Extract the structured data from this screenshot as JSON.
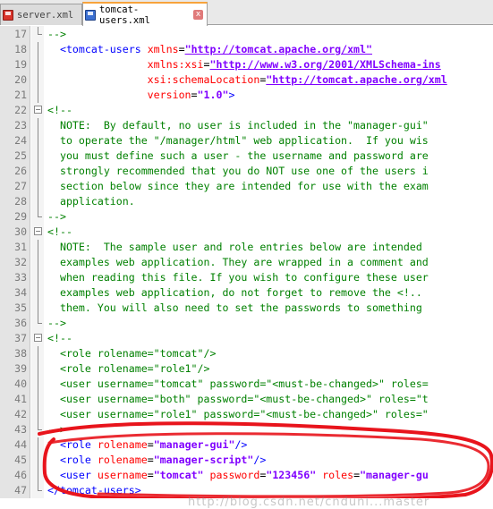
{
  "tabs": [
    {
      "label": "server.xml",
      "active": false,
      "icon": "floppy-red-icon"
    },
    {
      "label": "tomcat-users.xml",
      "active": true,
      "icon": "floppy-blue-icon"
    }
  ],
  "tab_close_glyph": "x",
  "watermark": "http://blog.csdn.net/cnduni...master",
  "lines": [
    {
      "n": "17",
      "fold": "end",
      "segs": [
        {
          "t": "-->",
          "c": "c-comment"
        }
      ]
    },
    {
      "n": "18",
      "fold": "vline",
      "segs": [
        {
          "t": "  ",
          "c": ""
        },
        {
          "t": "<tomcat-users",
          "c": "c-tag"
        },
        {
          "t": " xmlns",
          "c": "c-attr"
        },
        {
          "t": "=",
          "c": "c-eq"
        },
        {
          "t": "\"http://tomcat.apache.org/xml\"",
          "c": "c-url"
        }
      ]
    },
    {
      "n": "19",
      "fold": "vline",
      "segs": [
        {
          "t": "                xmlns:xsi",
          "c": "c-attr"
        },
        {
          "t": "=",
          "c": "c-eq"
        },
        {
          "t": "\"http://www.w3.org/2001/XMLSchema-ins",
          "c": "c-url"
        }
      ]
    },
    {
      "n": "20",
      "fold": "vline",
      "segs": [
        {
          "t": "                xsi:schemaLocation",
          "c": "c-attr"
        },
        {
          "t": "=",
          "c": "c-eq"
        },
        {
          "t": "\"http://tomcat.apache.org/xml",
          "c": "c-url"
        }
      ]
    },
    {
      "n": "21",
      "fold": "vline",
      "segs": [
        {
          "t": "                version",
          "c": "c-attr"
        },
        {
          "t": "=",
          "c": "c-eq"
        },
        {
          "t": "\"1.0\"",
          "c": "c-val"
        },
        {
          "t": ">",
          "c": "c-tag"
        }
      ]
    },
    {
      "n": "22",
      "fold": "box",
      "segs": [
        {
          "t": "<!--",
          "c": "c-comment"
        }
      ]
    },
    {
      "n": "23",
      "fold": "vline",
      "segs": [
        {
          "t": "  NOTE:  By default, no user is included in the \"manager-gui\"",
          "c": "c-comment"
        }
      ]
    },
    {
      "n": "24",
      "fold": "vline",
      "segs": [
        {
          "t": "  to operate the \"/manager/html\" web application.  If you wis",
          "c": "c-comment"
        }
      ]
    },
    {
      "n": "25",
      "fold": "vline",
      "segs": [
        {
          "t": "  you must define such a user - the username and password are",
          "c": "c-comment"
        }
      ]
    },
    {
      "n": "26",
      "fold": "vline",
      "segs": [
        {
          "t": "  strongly recommended that you do NOT use one of the users i",
          "c": "c-comment"
        }
      ]
    },
    {
      "n": "27",
      "fold": "vline",
      "segs": [
        {
          "t": "  section below since they are intended for use with the exam",
          "c": "c-comment"
        }
      ]
    },
    {
      "n": "28",
      "fold": "vline",
      "segs": [
        {
          "t": "  application.",
          "c": "c-comment"
        }
      ]
    },
    {
      "n": "29",
      "fold": "end",
      "segs": [
        {
          "t": "-->",
          "c": "c-comment"
        }
      ]
    },
    {
      "n": "30",
      "fold": "box",
      "segs": [
        {
          "t": "<!--",
          "c": "c-comment"
        }
      ]
    },
    {
      "n": "31",
      "fold": "vline",
      "segs": [
        {
          "t": "  NOTE:  The sample user and role entries below are intended",
          "c": "c-comment"
        }
      ]
    },
    {
      "n": "32",
      "fold": "vline",
      "segs": [
        {
          "t": "  examples web application. They are wrapped in a comment and",
          "c": "c-comment"
        }
      ]
    },
    {
      "n": "33",
      "fold": "vline",
      "segs": [
        {
          "t": "  when reading this file. If you wish to configure these user",
          "c": "c-comment"
        }
      ]
    },
    {
      "n": "34",
      "fold": "vline",
      "segs": [
        {
          "t": "  examples web application, do not forget to remove the <!..",
          "c": "c-comment"
        }
      ]
    },
    {
      "n": "35",
      "fold": "vline",
      "segs": [
        {
          "t": "  them. You will also need to set the passwords to something",
          "c": "c-comment"
        }
      ]
    },
    {
      "n": "36",
      "fold": "end",
      "segs": [
        {
          "t": "-->",
          "c": "c-comment"
        }
      ]
    },
    {
      "n": "37",
      "fold": "box",
      "segs": [
        {
          "t": "<!--",
          "c": "c-comment"
        }
      ]
    },
    {
      "n": "38",
      "fold": "vline",
      "segs": [
        {
          "t": "  <role rolename=\"tomcat\"/>",
          "c": "c-comment"
        }
      ]
    },
    {
      "n": "39",
      "fold": "vline",
      "segs": [
        {
          "t": "  <role rolename=\"role1\"/>",
          "c": "c-comment"
        }
      ]
    },
    {
      "n": "40",
      "fold": "vline",
      "segs": [
        {
          "t": "  <user username=\"tomcat\" password=\"<must-be-changed>\" roles=",
          "c": "c-comment"
        }
      ]
    },
    {
      "n": "41",
      "fold": "vline",
      "segs": [
        {
          "t": "  <user username=\"both\" password=\"<must-be-changed>\" roles=\"t",
          "c": "c-comment"
        }
      ]
    },
    {
      "n": "42",
      "fold": "vline",
      "segs": [
        {
          "t": "  <user username=\"role1\" password=\"<must-be-changed>\" roles=\"",
          "c": "c-comment"
        }
      ]
    },
    {
      "n": "43",
      "fold": "end",
      "segs": [
        {
          "t": "-->",
          "c": "c-comment"
        }
      ]
    },
    {
      "n": "44",
      "fold": "vline",
      "segs": [
        {
          "t": "  ",
          "c": ""
        },
        {
          "t": "<role",
          "c": "c-tag"
        },
        {
          "t": " rolename",
          "c": "c-attr"
        },
        {
          "t": "=",
          "c": "c-eq"
        },
        {
          "t": "\"manager-gui\"",
          "c": "c-val"
        },
        {
          "t": "/>",
          "c": "c-tag"
        }
      ]
    },
    {
      "n": "45",
      "fold": "vline",
      "segs": [
        {
          "t": "  ",
          "c": ""
        },
        {
          "t": "<role",
          "c": "c-tag"
        },
        {
          "t": " rolename",
          "c": "c-attr"
        },
        {
          "t": "=",
          "c": "c-eq"
        },
        {
          "t": "\"manager-script\"",
          "c": "c-val"
        },
        {
          "t": "/>",
          "c": "c-tag"
        }
      ]
    },
    {
      "n": "46",
      "fold": "vline",
      "segs": [
        {
          "t": "  ",
          "c": ""
        },
        {
          "t": "<user",
          "c": "c-tag"
        },
        {
          "t": " username",
          "c": "c-attr"
        },
        {
          "t": "=",
          "c": "c-eq"
        },
        {
          "t": "\"tomcat\"",
          "c": "c-val"
        },
        {
          "t": " password",
          "c": "c-attr"
        },
        {
          "t": "=",
          "c": "c-eq"
        },
        {
          "t": "\"123456\"",
          "c": "c-val"
        },
        {
          "t": " roles",
          "c": "c-attr"
        },
        {
          "t": "=",
          "c": "c-eq"
        },
        {
          "t": "\"manager-gu",
          "c": "c-val"
        }
      ]
    },
    {
      "n": "47",
      "fold": "end",
      "segs": [
        {
          "t": "</tomcat-users>",
          "c": "c-tag"
        }
      ]
    }
  ]
}
